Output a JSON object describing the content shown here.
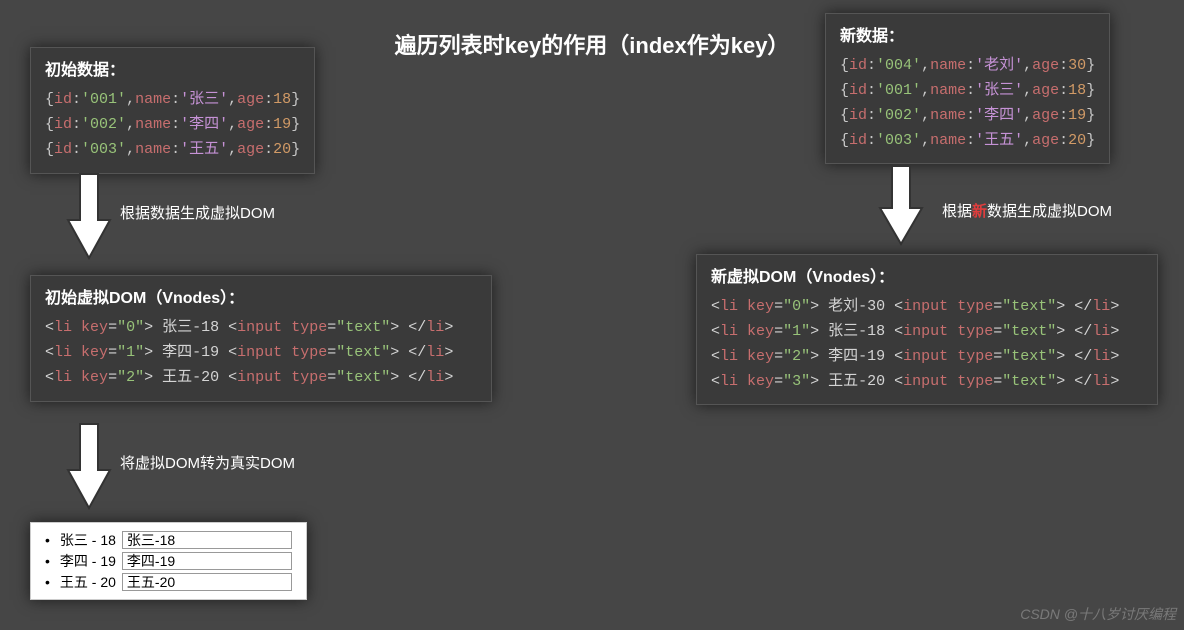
{
  "title": "遍历列表时key的作用（index作为key）",
  "init_data": {
    "header": "初始数据：",
    "rows": [
      {
        "id": "001",
        "name": "张三",
        "age": 18
      },
      {
        "id": "002",
        "name": "李四",
        "age": 19
      },
      {
        "id": "003",
        "name": "王五",
        "age": 20
      }
    ]
  },
  "new_data": {
    "header": "新数据：",
    "rows": [
      {
        "id": "004",
        "name": "老刘",
        "age": 30
      },
      {
        "id": "001",
        "name": "张三",
        "age": 18
      },
      {
        "id": "002",
        "name": "李四",
        "age": 19
      },
      {
        "id": "003",
        "name": "王五",
        "age": 20
      }
    ]
  },
  "labels": {
    "gen_vdom": "根据数据生成虚拟DOM",
    "gen_vdom_new_pre": "根据",
    "gen_vdom_new_hl": "新",
    "gen_vdom_new_post": "数据生成虚拟DOM",
    "to_real": "将虚拟DOM转为真实DOM"
  },
  "init_vnodes": {
    "header": "初始虚拟DOM（Vnodes）：",
    "rows": [
      {
        "key": "0",
        "text": "张三-18"
      },
      {
        "key": "1",
        "text": "李四-19"
      },
      {
        "key": "2",
        "text": "王五-20"
      }
    ]
  },
  "new_vnodes": {
    "header": "新虚拟DOM（Vnodes）：",
    "rows": [
      {
        "key": "0",
        "text": "老刘-30"
      },
      {
        "key": "1",
        "text": "张三-18"
      },
      {
        "key": "2",
        "text": "李四-19"
      },
      {
        "key": "3",
        "text": "王五-20"
      }
    ]
  },
  "real_dom": [
    {
      "label": "张三 - 18",
      "value": "张三-18"
    },
    {
      "label": "李四 - 19",
      "value": "李四-19"
    },
    {
      "label": "王五 - 20",
      "value": "王五-20"
    }
  ],
  "watermark": "CSDN @十八岁讨厌编程"
}
